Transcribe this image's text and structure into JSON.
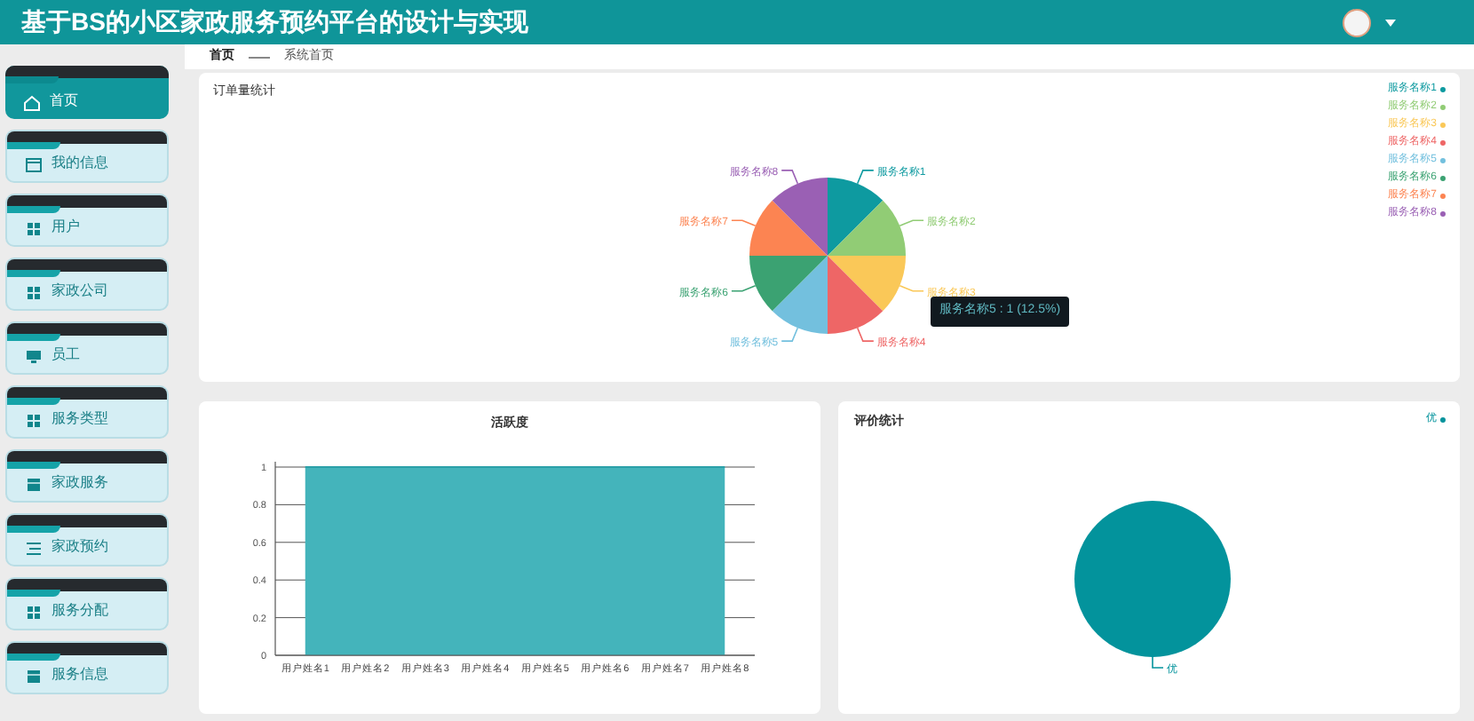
{
  "header": {
    "title": "基于BS的小区家政服务预约平台的设计与实现"
  },
  "sidebar": {
    "items": [
      {
        "label": "首页",
        "kind": "home",
        "selected": true
      },
      {
        "label": "我的信息",
        "kind": "window",
        "selected": false
      },
      {
        "label": "用户",
        "kind": "grid",
        "selected": false
      },
      {
        "label": "家政公司",
        "kind": "grid",
        "selected": false
      },
      {
        "label": "员工",
        "kind": "monitor",
        "selected": false
      },
      {
        "label": "服务类型",
        "kind": "grid",
        "selected": false
      },
      {
        "label": "家政服务",
        "kind": "box",
        "selected": false
      },
      {
        "label": "家政预约",
        "kind": "list",
        "selected": false
      },
      {
        "label": "服务分配",
        "kind": "grid",
        "selected": false
      },
      {
        "label": "服务信息",
        "kind": "box",
        "selected": false
      }
    ]
  },
  "breadcrumb": [
    "首页",
    "系统首页"
  ],
  "order_chart": {
    "title": "订单量统计",
    "tooltip": "服务名称5 : 1 (12.5%)",
    "chart_data": {
      "type": "pie",
      "categories": [
        "服务名称1",
        "服务名称2",
        "服务名称3",
        "服务名称4",
        "服务名称5",
        "服务名称6",
        "服务名称7",
        "服务名称8"
      ],
      "values": [
        1,
        1,
        1,
        1,
        1,
        1,
        1,
        1
      ],
      "colors": [
        "#0e9aa0",
        "#91cc75",
        "#fac858",
        "#ee6666",
        "#73c0de",
        "#3ba272",
        "#fc8452",
        "#9a60b4"
      ]
    }
  },
  "activity_chart": {
    "chart_data": {
      "type": "area",
      "title": "活跃度",
      "grid": true,
      "categories": [
        "用户姓名1",
        "用户姓名2",
        "用户姓名3",
        "用户姓名4",
        "用户姓名5",
        "用户姓名6",
        "用户姓名7",
        "用户姓名8"
      ],
      "values": [
        1,
        1,
        1,
        1,
        1,
        1,
        1,
        1
      ],
      "ylim": [
        0,
        1
      ],
      "yticks": [
        {
          "value": 0,
          "label": "0"
        },
        {
          "value": 0.2,
          "label": "0.2"
        },
        {
          "value": 0.4,
          "label": "0.4"
        },
        {
          "value": 0.6,
          "label": "0.6"
        },
        {
          "value": 0.8,
          "label": "0.8"
        },
        {
          "value": 1,
          "label": "1"
        }
      ]
    }
  },
  "rating_chart": {
    "title": "评价统计",
    "legend": [
      {
        "label": "优",
        "color": "#03939c"
      }
    ],
    "slices": [
      {
        "label": "优",
        "color": "#03939c"
      }
    ]
  }
}
